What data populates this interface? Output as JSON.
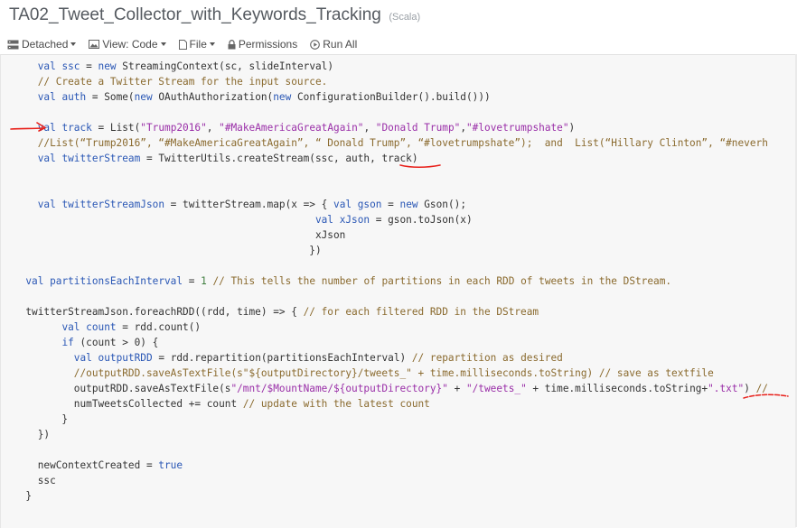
{
  "header": {
    "title": "TA02_Tweet_Collector_with_Keywords_Tracking",
    "language": "(Scala)"
  },
  "toolbar": {
    "detached": "Detached",
    "view": "View: Code",
    "file": "File",
    "permissions": "Permissions",
    "run_all": "Run All"
  },
  "code_lines": [
    "    val ssc = new StreamingContext(sc, slideInterval)",
    "    // Create a Twitter Stream for the input source.",
    "    val auth = Some(new OAuthAuthorization(new ConfigurationBuilder().build()))",
    "",
    "    val track = List(\"Trump2016\", \"#MakeAmericaGreatAgain\", \"Donald Trump\",\"#lovetrumpshate\")",
    "    //List(“Trump2016”, “#MakeAmericaGreatAgain”, “ Donald Trump”, “#lovetrumpshate”);  and  List(“Hillary Clinton”, “#neverh",
    "    val twitterStream = TwitterUtils.createStream(ssc, auth, track)",
    "",
    "",
    "    val twitterStreamJson = twitterStream.map(x => { val gson = new Gson();",
    "                                                  val xJson = gson.toJson(x)",
    "                                                  xJson",
    "                                                 })",
    "",
    "  val partitionsEachInterval = 1 // This tells the number of partitions in each RDD of tweets in the DStream.",
    "",
    "  twitterStreamJson.foreachRDD((rdd, time) => { // for each filtered RDD in the DStream",
    "        val count = rdd.count()",
    "        if (count > 0) {",
    "          val outputRDD = rdd.repartition(partitionsEachInterval) // repartition as desired",
    "          //outputRDD.saveAsTextFile(s\"${outputDirectory}/tweets_\" + time.milliseconds.toString) // save as textfile",
    "          outputRDD.saveAsTextFile(s\"/mnt/$MountName/${outputDirectory}\" + \"/tweets_\" + time.milliseconds.toString+\".txt\") //",
    "          numTweetsCollected += count // update with the latest count",
    "        }",
    "    })",
    "",
    "    newContextCreated = true",
    "    ssc",
    "  }"
  ],
  "colors": {
    "keyword": "#2a57b5",
    "string": "#9a2fa8",
    "comment": "#8a6a2e",
    "number": "#3d7d3d",
    "annotation": "#e8201a"
  }
}
